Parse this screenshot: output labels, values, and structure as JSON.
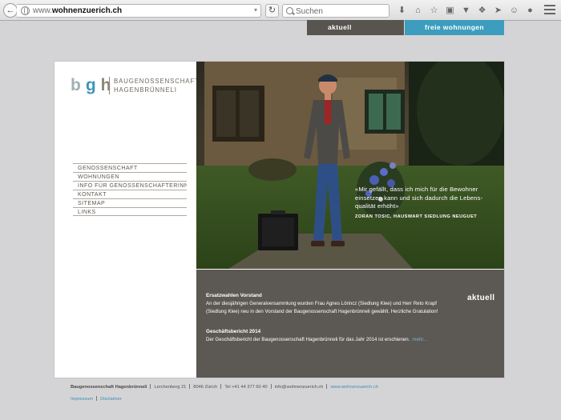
{
  "browser": {
    "url_host_prefix": "www.",
    "url_host_bold": "wohnenzuerich.ch",
    "search_placeholder": "Suchen",
    "icons": [
      "download-icon",
      "home-icon",
      "star-icon",
      "reading-list-icon",
      "pocket-icon",
      "addon-icon",
      "send-icon",
      "smiley-icon",
      "chat-icon"
    ]
  },
  "header_tabs": {
    "aktuell": "aktuell",
    "freie_wohnungen": "freie wohnungen"
  },
  "colors": {
    "tab_dark": "#585450",
    "tab_blue": "#3d9dbe",
    "news_bg": "#5c5853",
    "link_blue": "#3f8db3"
  },
  "logo": {
    "b": "b",
    "g": "g",
    "h": "h",
    "line1": "BAUGENOSSENSCHAFT",
    "line2": "HAGENBRÜNNELI"
  },
  "nav": [
    "GENOSSENSCHAFT",
    "WOHNUNGEN",
    "INFO FÜR GENOSSENSCHAFTERINNEN",
    "KONTAKT",
    "SITEMAP",
    "LINKS"
  ],
  "hero": {
    "quote": "«Mir gefällt, dass ich mich für die Bewohner einsetzen kann und sich dadurch die Lebens­qualität erhöht»",
    "author": "ZORAN TOSIC, HAUSWART SIEDLUNG NEUGUET"
  },
  "news": {
    "label": "aktuell",
    "items": [
      {
        "title": "Ersatzwahlen Vorstand",
        "body": "An der diesjährigen Generalversammlung wurden Frau Agnes Lörincz (Siedlung Klee) und Herr Reto Krapf (Siedlung Klee) neu in den Vorstand der Baugenossenschaft Hagenbrünneli gewählt. Herzliche Gratulation!"
      },
      {
        "title": "Geschäftsbericht 2014",
        "body": "Der Geschäftsbericht der Baugenossenschaft Hagenbrünneli für das Jahr 2014 ist erschienen.",
        "more": "mehr..."
      }
    ]
  },
  "footer": {
    "org": "Baugenossenschaft Hagenbrünneli",
    "street": "Lerchenberg 21",
    "city": "8046 Zürich",
    "phone": "Tel +41 44 377 60 40",
    "email": "info@wohnenzuerich.ch",
    "web": "www.wohnenzuerich.ch",
    "impressum": "Impressum",
    "disclaimer": "Disclaimer"
  }
}
